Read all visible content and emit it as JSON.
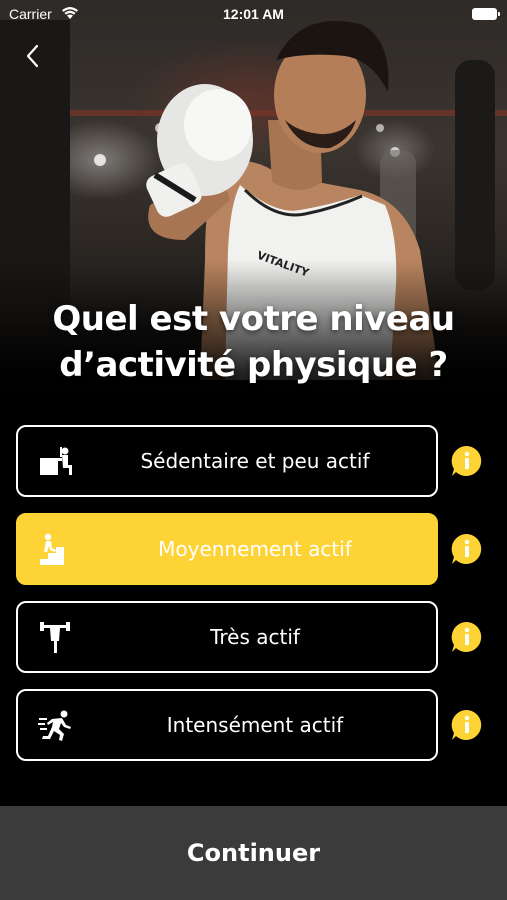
{
  "status_bar": {
    "carrier": "Carrier",
    "time": "12:01 AM"
  },
  "header": {
    "title_line1": "Quel est votre niveau",
    "title_line2": "d’activité physique ?",
    "hero_shirt_text": "VITALITY"
  },
  "options": [
    {
      "label": "Sédentaire et peu actif",
      "icon": "desk-sitting-icon",
      "selected": false
    },
    {
      "label": "Moyennement actif",
      "icon": "stairs-climbing-icon",
      "selected": true
    },
    {
      "label": "Très actif",
      "icon": "weight-lifting-icon",
      "selected": false
    },
    {
      "label": "Intensément actif",
      "icon": "running-icon",
      "selected": false
    }
  ],
  "continue_label": "Continuer",
  "colors": {
    "accent": "#fdd335",
    "background": "#000000",
    "bottom_bar": "#3b3b3b"
  }
}
